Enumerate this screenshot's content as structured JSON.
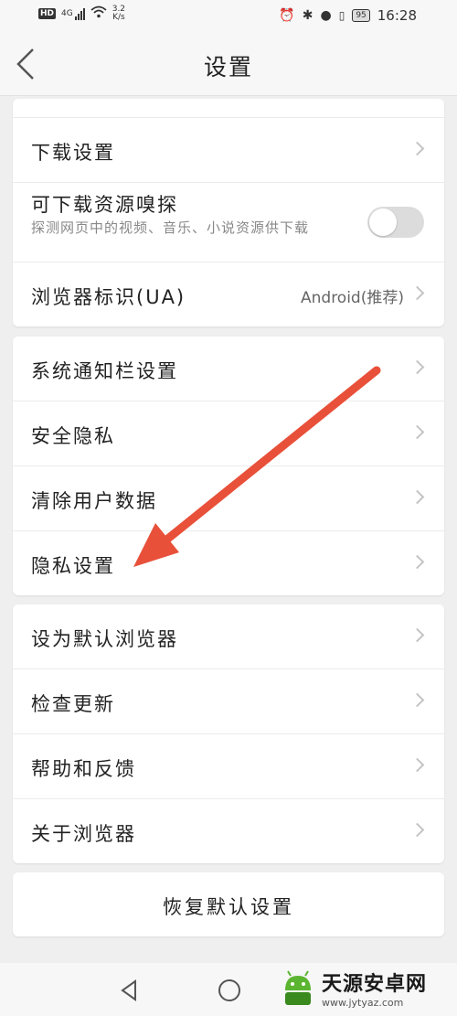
{
  "status": {
    "hd": "HD",
    "net": "4G",
    "speed_value": "3.2",
    "speed_unit": "K/s",
    "battery": "95",
    "time": "16:28"
  },
  "header": {
    "title": "设置"
  },
  "group1": {
    "download_settings": "下载设置",
    "sniff_title": "可下载资源嗅探",
    "sniff_desc": "探测网页中的视频、音乐、小说资源供下载",
    "sniff_enabled": false,
    "ua_label": "浏览器标识(UA)",
    "ua_value": "Android(推荐)"
  },
  "group2": {
    "items": [
      "系统通知栏设置",
      "安全隐私",
      "清除用户数据",
      "隐私设置"
    ]
  },
  "group3": {
    "items": [
      "设为默认浏览器",
      "检查更新",
      "帮助和反馈",
      "关于浏览器"
    ]
  },
  "restore_label": "恢复默认设置",
  "watermark": {
    "name": "天源安卓网",
    "url": "www.jytyaz.com"
  },
  "colors": {
    "arrow": "#e8503a",
    "background": "#efefef",
    "card": "#ffffff"
  }
}
